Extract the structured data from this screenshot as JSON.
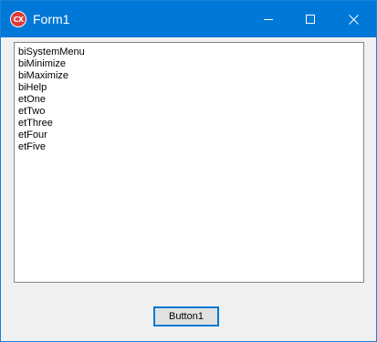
{
  "window": {
    "title": "Form1",
    "app_icon": {
      "name": "app-icon",
      "text": "CX",
      "color": "#e03a3a"
    },
    "titlebar_color": "#0078d7"
  },
  "listbox": {
    "items": [
      "biSystemMenu",
      "biMinimize",
      "biMaximize",
      "biHelp",
      "etOne",
      "etTwo",
      "etThree",
      "etFour",
      "etFive"
    ]
  },
  "button1": {
    "label": "Button1"
  },
  "icons": [
    "minimize-icon",
    "maximize-icon",
    "close-icon"
  ]
}
